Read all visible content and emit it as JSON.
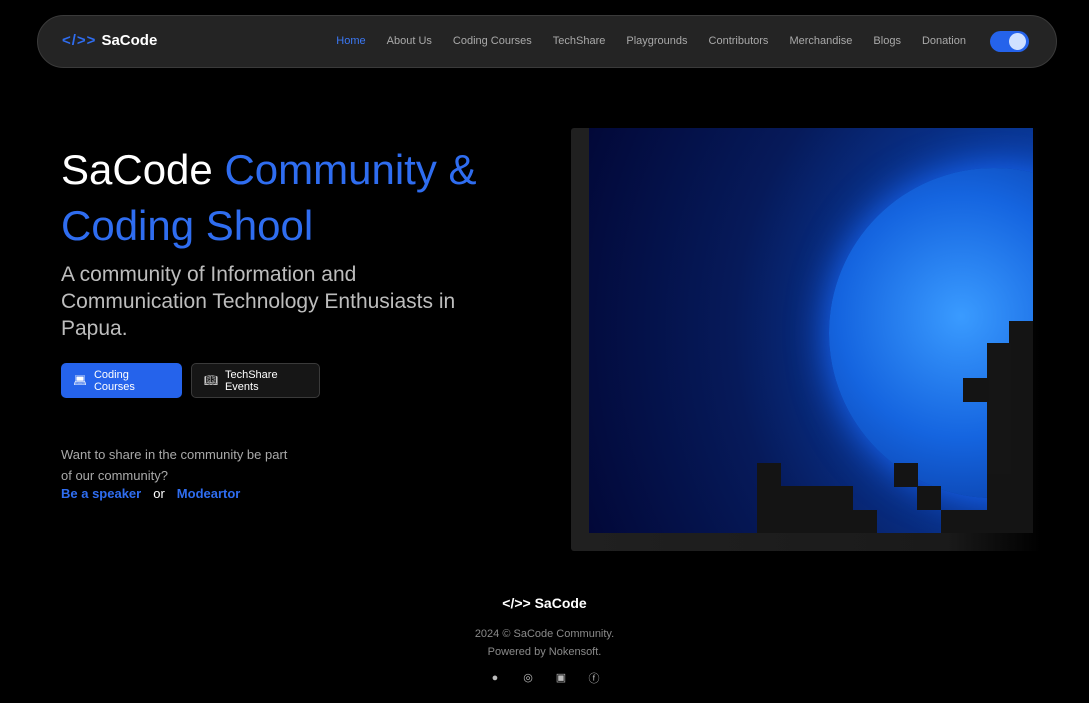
{
  "nav": {
    "logo_mark": "</>>",
    "logo_text": "SaCode",
    "items": [
      "Home",
      "About Us",
      "Coding Courses",
      "TechShare",
      "Playgrounds",
      "Contributors",
      "Merchandise",
      "Blogs",
      "Donation"
    ],
    "active": "Home",
    "theme_toggle": "on"
  },
  "hero": {
    "title_white": "SaCode",
    "title_blue": "Community & Coding Shool",
    "subtitle": "A community of Information and Communication Technology Enthusiasts in Papua.",
    "btn_courses": "Coding Courses",
    "btn_events": "TechShare Events",
    "share_text": "Want to share in the community be part of our community?",
    "link_speaker": "Be a speaker",
    "or": "or",
    "link_moderator": "Modeartor"
  },
  "footer": {
    "logo_mark": "</>>",
    "logo_text": "SaCode",
    "copyright": "2024 © SaCode Community.",
    "powered": "Powered by Nokensoft."
  },
  "colors": {
    "accent": "#2563eb",
    "bg": "#000000",
    "nav": "#242424"
  }
}
